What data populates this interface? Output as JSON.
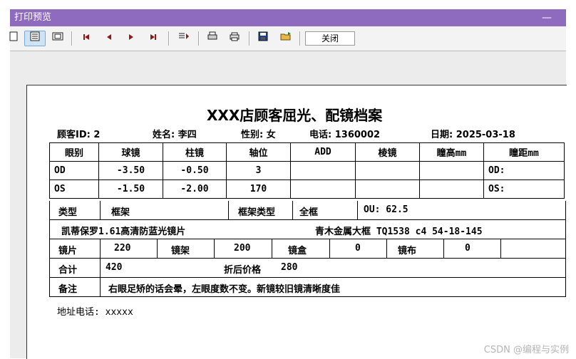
{
  "window": {
    "title": "打印预览",
    "minimize_glyph": "—"
  },
  "toolbar": {
    "close_label": "关闭",
    "icons": [
      "page-icon",
      "multi-page-icon",
      "fit-icon",
      "first-page-icon",
      "prev-page-icon",
      "next-page-icon",
      "last-page-icon",
      "page-range-icon",
      "print-setup-icon",
      "print-icon",
      "save-icon",
      "open-icon"
    ]
  },
  "doc": {
    "title": "XXX店顾客屈光、配镜档案",
    "fields": {
      "customer_id": "顾客ID: 2",
      "name": "姓名: 李四",
      "gender": "性别: 女",
      "phone": "电话: 1360002",
      "date": "日期: 2025-03-18"
    },
    "table": {
      "headers": [
        "眼别",
        "球镜",
        "柱镜",
        "轴位",
        "ADD",
        "棱镜",
        "瞳高mm",
        "瞳距mm"
      ],
      "rows": [
        [
          "OD",
          "-3.50",
          "-0.50",
          "3",
          "",
          "",
          "",
          "OD:"
        ],
        [
          "OS",
          "-1.50",
          "-2.00",
          "170",
          "",
          "",
          "",
          "OS:"
        ]
      ]
    },
    "type_row": {
      "type_label": "类型",
      "type_value": "框架",
      "frame_type_label": "框架类型",
      "frame_type_value": "全框",
      "ou": "OU: 62.5"
    },
    "lens_row": {
      "lens_desc": "凯蒂保罗1.61高清防蓝光镜片",
      "frame_desc": "青木金属大框 TQ1538 c4 54-18-145"
    },
    "price_row": {
      "lens_label": "镜片",
      "lens_price": "220",
      "frame_label": "镜架",
      "frame_price": "200",
      "case_label": "镜盒",
      "case_price": "0",
      "cloth_label": "镜布",
      "cloth_price": "0"
    },
    "total_row": {
      "total_label": "合计",
      "total_value": "420",
      "discount_label": "折后价格",
      "discount_value": "280"
    },
    "note_row": {
      "note_label": "备注",
      "note_value": "右眼足矫的话会晕，左眼度数不变。新镜较旧镜清晰度佳"
    },
    "address": "地址电话: xxxxx"
  },
  "watermark": "CSDN @编程与实例"
}
